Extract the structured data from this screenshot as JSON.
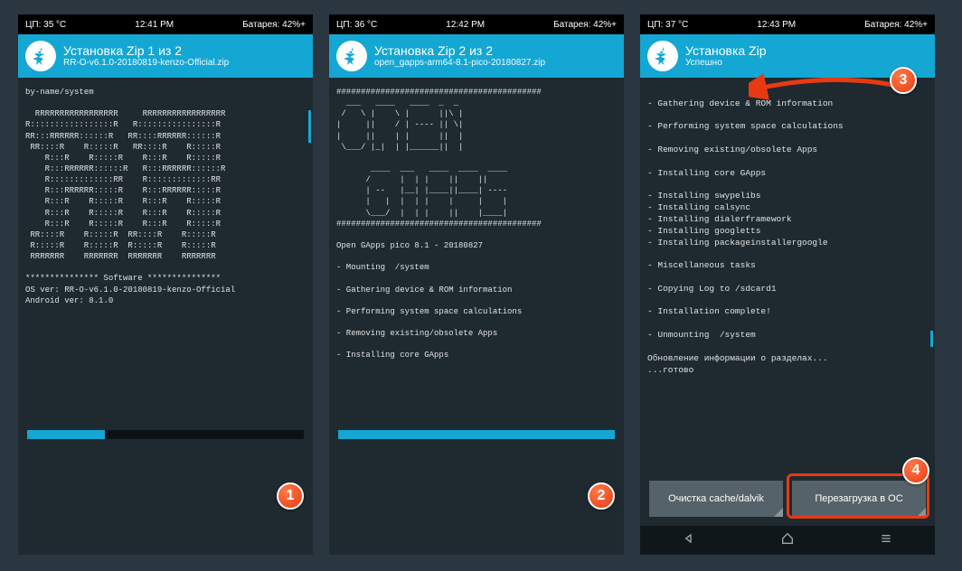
{
  "screens": [
    {
      "status": {
        "cpu": "ЦП: 35 °C",
        "time": "12:41 PM",
        "battery": "Батарея: 42%+"
      },
      "header": {
        "title": "Установка Zip 1 из 2",
        "subtitle": "RR-O-v6.1.0-20180819-kenzo-Official.zip"
      },
      "terminal": "by-name/system\n\n  RRRRRRRRRRRRRRRRR     RRRRRRRRRRRRRRRRR\nR:::::::::::::::::R   R::::::::::::::::R\nRR:::RRRRRR::::::R   RR::::RRRRRR::::::R\n RR::::R    R:::::R   RR::::R    R:::::R\n    R:::R    R:::::R    R:::R    R:::::R\n    R:::RRRRRR::::::R   R:::RRRRRR::::::R\n    R:::::::::::::RR    R:::::::::::::RR\n    R:::RRRRRR:::::R    R:::RRRRRR:::::R\n    R:::R    R:::::R    R:::R    R:::::R\n    R:::R    R:::::R    R:::R    R:::::R\n    R:::R    R:::::R    R:::R    R:::::R\n RR::::R    R:::::R  RR::::R    R:::::R\n R:::::R    R:::::R  R:::::R    R:::::R\n RRRRRRR    RRRRRRR  RRRRRRR    RRRRRRR\n\n*************** Software ***************\nOS ver: RR-O-v6.1.0-20180819-kenzo-Official\nAndroid ver: 8.1.0\n",
      "progress": 28,
      "badge": "1"
    },
    {
      "status": {
        "cpu": "ЦП: 36 °C",
        "time": "12:42 PM",
        "battery": "Батарея: 42%+"
      },
      "header": {
        "title": "Установка Zip 2 из 2",
        "subtitle": "open_gapps-arm64-8.1-pico-20180827.zip"
      },
      "terminal": "##########################################\n  ___   ____   ____  _  _\n /   \\ |    \\ |      ||\\ |\n|     ||    / | ---- || \\|\n|     ||    | |      ||  |\n \\___/ |_|  | |______||  |\n\n       ____  ___   ____  ____  ____\n      /      |  | |    ||    ||\n      | --   |__| |____||____| ----\n      |   |  |  | |    |     |    |\n      \\___/  |  | |    ||    |____|\n##########################################\n\nOpen GApps pico 8.1 - 20180827\n\n- Mounting  /system\n\n- Gathering device & ROM information\n\n- Performing system space calculations\n\n- Removing existing/obsolete Apps\n\n- Installing core GApps",
      "progress": 100,
      "badge": "2"
    },
    {
      "status": {
        "cpu": "ЦП: 37 °C",
        "time": "12:43 PM",
        "battery": "Батарея: 42%+"
      },
      "header": {
        "title": "Установка Zip",
        "subtitle": "Успешно"
      },
      "terminal": "\n- Gathering device & ROM information\n\n- Performing system space calculations\n\n- Removing existing/obsolete Apps\n\n- Installing core GApps\n\n- Installing swypelibs\n- Installing calsync\n- Installing dialerframework\n- Installing googletts\n- Installing packageinstallergoogle\n\n- Miscellaneous tasks\n\n- Copying Log to /sdcard1\n\n- Installation complete!\n\n- Unmounting  /system\n\nОбновление информации о разделах...\n...готово",
      "buttons": {
        "left": "Очистка cache/dalvik",
        "right": "Перезагрузка в ОС"
      },
      "badge3": "3",
      "badge4": "4"
    }
  ]
}
